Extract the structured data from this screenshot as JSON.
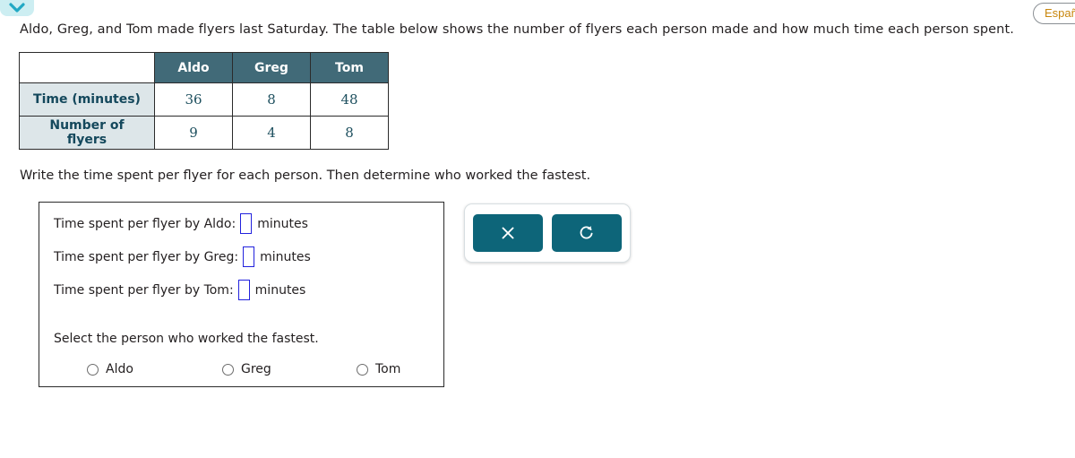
{
  "header": {
    "chevron_icon": "chevron-down-icon",
    "language_button_label": "Español"
  },
  "prompt": "Aldo, Greg, and Tom made flyers last Saturday. The table below shows the number of flyers each person made and how much time each person spent.",
  "sub_instruction": "Write the time spent per flyer for each person. Then determine who worked the fastest.",
  "table": {
    "corner_label": "",
    "columns": [
      "Aldo",
      "Greg",
      "Tom"
    ],
    "rows": [
      {
        "label": "Time (minutes)",
        "values": [
          "36",
          "8",
          "48"
        ]
      },
      {
        "label": "Number of flyers",
        "values": [
          "9",
          "4",
          "8"
        ]
      }
    ]
  },
  "answers": {
    "entries": [
      {
        "label": "Time spent per flyer by Aldo:",
        "value": "",
        "units": "minutes"
      },
      {
        "label": "Time spent per flyer by Greg:",
        "value": "",
        "units": "minutes"
      },
      {
        "label": "Time spent per flyer by Tom:",
        "value": "",
        "units": "minutes"
      }
    ],
    "select_prompt": "Select the person who worked the fastest.",
    "options": [
      {
        "label": "Aldo",
        "selected": false
      },
      {
        "label": "Greg",
        "selected": false
      },
      {
        "label": "Tom",
        "selected": false
      }
    ]
  },
  "tools": {
    "clear_label": "×",
    "clear_icon": "close-x-icon",
    "undo_label": "↺",
    "undo_icon": "undo-circular-arrow-icon"
  },
  "colors": {
    "table_header": "#416a78",
    "row_label_bg": "#dde6e9",
    "row_label_text": "#14485c",
    "data_text": "#1d4f5e",
    "teal_button": "#0d6579",
    "chevron_tab_bg": "#cdeef2",
    "chevron_glyph": "#21a8c4",
    "input_border": "#2222dd",
    "language_text": "#c8860d"
  }
}
